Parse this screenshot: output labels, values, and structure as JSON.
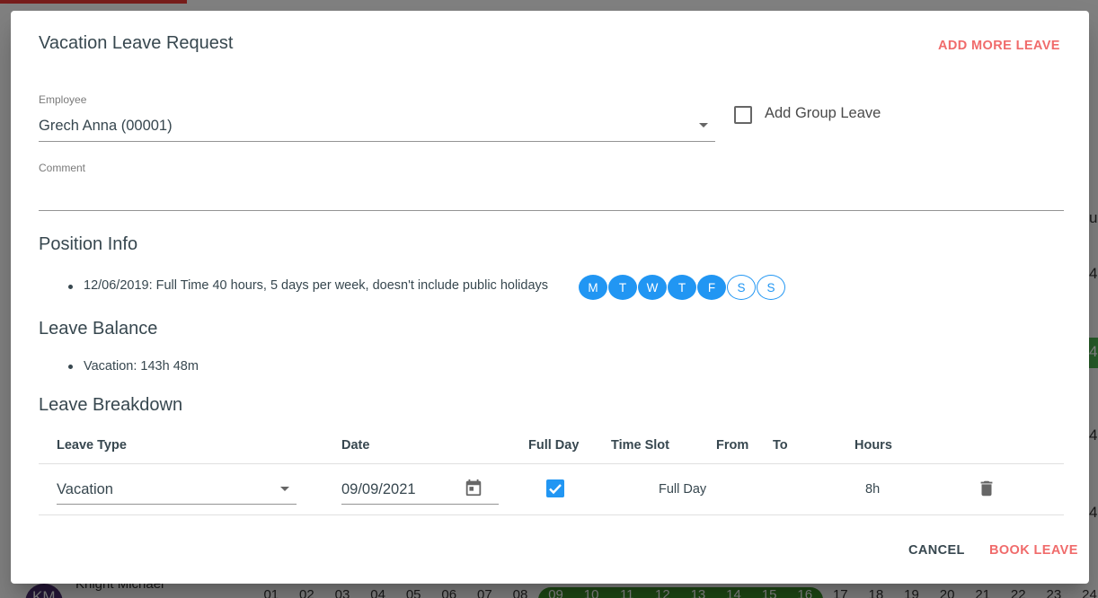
{
  "background": {
    "name": "Knight Michael",
    "avatar_initials": "KM",
    "days": [
      "01",
      "02",
      "03",
      "04",
      "05",
      "06",
      "07",
      "08",
      "09",
      "10",
      "11",
      "12",
      "13",
      "14",
      "15",
      "16",
      "17",
      "18",
      "19",
      "20",
      "21",
      "22",
      "23",
      "24"
    ],
    "highlight_days": [
      "09",
      "10",
      "11",
      "12",
      "13",
      "14",
      "15",
      "16"
    ],
    "right_values": [
      "u",
      "4",
      "4",
      "4",
      "4"
    ]
  },
  "dialog": {
    "title": "Vacation Leave Request",
    "add_more_label": "ADD MORE LEAVE",
    "employee": {
      "label": "Employee",
      "value": "Grech Anna (00001)"
    },
    "group_leave": {
      "label": "Add Group Leave",
      "checked": false
    },
    "comment": {
      "label": "Comment",
      "value": ""
    },
    "position_info": {
      "heading": "Position Info",
      "text": "12/06/2019: Full Time 40 hours, 5 days per week, doesn't include public holidays",
      "days": [
        {
          "label": "M",
          "active": true
        },
        {
          "label": "T",
          "active": true
        },
        {
          "label": "W",
          "active": true
        },
        {
          "label": "T",
          "active": true
        },
        {
          "label": "F",
          "active": true
        },
        {
          "label": "S",
          "active": false
        },
        {
          "label": "S",
          "active": false
        }
      ]
    },
    "leave_balance": {
      "heading": "Leave Balance",
      "text": "Vacation: 143h 48m"
    },
    "leave_breakdown": {
      "heading": "Leave Breakdown",
      "columns": {
        "leave_type": "Leave Type",
        "date": "Date",
        "full_day": "Full Day",
        "time_slot": "Time Slot",
        "from": "From",
        "to": "To",
        "hours": "Hours"
      },
      "rows": [
        {
          "leave_type": "Vacation",
          "date": "09/09/2021",
          "full_day": true,
          "time_slot": "Full Day",
          "from": "",
          "to": "",
          "hours": "8h"
        }
      ]
    },
    "actions": {
      "cancel": "CANCEL",
      "book": "BOOK LEAVE"
    }
  },
  "colors": {
    "accent": "#2196f3",
    "action_red": "#f06b6b",
    "text": "#37474f"
  }
}
